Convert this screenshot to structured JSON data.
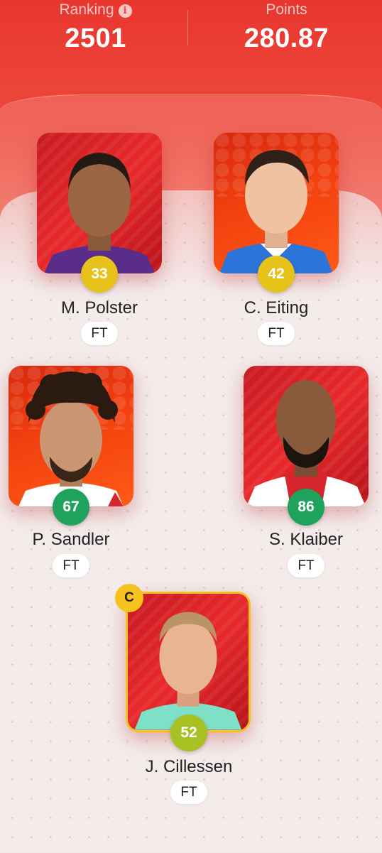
{
  "header": {
    "ranking_label": "Ranking",
    "ranking_value": "2501",
    "points_label": "Points",
    "points_value": "280.87"
  },
  "captain_badge": "C",
  "players": [
    {
      "name": "M. Polster",
      "score": "33",
      "status": "FT",
      "score_color": "#e6c21a",
      "shirt_color": "#5a2d8a"
    },
    {
      "name": "C. Eiting",
      "score": "42",
      "status": "FT",
      "score_color": "#e6c21a",
      "shirt_color": "#2d74d8"
    },
    {
      "name": "P. Sandler",
      "score": "67",
      "status": "FT",
      "score_color": "#1fa25b",
      "shirt_color": "#ffffff"
    },
    {
      "name": "S. Klaiber",
      "score": "86",
      "status": "FT",
      "score_color": "#1fa25b",
      "shirt_color": "#ffffff"
    },
    {
      "name": "J. Cillessen",
      "score": "52",
      "status": "FT",
      "score_color": "#a8c224",
      "shirt_color": "#7fe0c8",
      "captain": true
    }
  ],
  "colors": {
    "header_red": "#e8362f",
    "captain_gold": "#f5c220"
  }
}
